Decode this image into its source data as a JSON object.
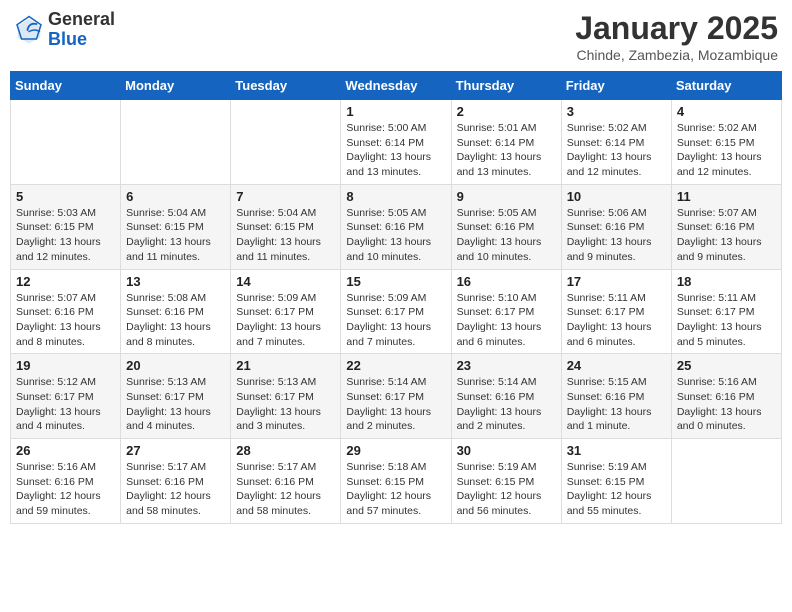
{
  "header": {
    "logo_general": "General",
    "logo_blue": "Blue",
    "month": "January 2025",
    "location": "Chinde, Zambezia, Mozambique"
  },
  "weekdays": [
    "Sunday",
    "Monday",
    "Tuesday",
    "Wednesday",
    "Thursday",
    "Friday",
    "Saturday"
  ],
  "weeks": [
    [
      {
        "day": "",
        "empty": true
      },
      {
        "day": "",
        "empty": true
      },
      {
        "day": "",
        "empty": true
      },
      {
        "day": "1",
        "sunrise": "5:00 AM",
        "sunset": "6:14 PM",
        "daylight": "13 hours and 13 minutes."
      },
      {
        "day": "2",
        "sunrise": "5:01 AM",
        "sunset": "6:14 PM",
        "daylight": "13 hours and 13 minutes."
      },
      {
        "day": "3",
        "sunrise": "5:02 AM",
        "sunset": "6:14 PM",
        "daylight": "13 hours and 12 minutes."
      },
      {
        "day": "4",
        "sunrise": "5:02 AM",
        "sunset": "6:15 PM",
        "daylight": "13 hours and 12 minutes."
      }
    ],
    [
      {
        "day": "5",
        "sunrise": "5:03 AM",
        "sunset": "6:15 PM",
        "daylight": "13 hours and 12 minutes."
      },
      {
        "day": "6",
        "sunrise": "5:04 AM",
        "sunset": "6:15 PM",
        "daylight": "13 hours and 11 minutes."
      },
      {
        "day": "7",
        "sunrise": "5:04 AM",
        "sunset": "6:15 PM",
        "daylight": "13 hours and 11 minutes."
      },
      {
        "day": "8",
        "sunrise": "5:05 AM",
        "sunset": "6:16 PM",
        "daylight": "13 hours and 10 minutes."
      },
      {
        "day": "9",
        "sunrise": "5:05 AM",
        "sunset": "6:16 PM",
        "daylight": "13 hours and 10 minutes."
      },
      {
        "day": "10",
        "sunrise": "5:06 AM",
        "sunset": "6:16 PM",
        "daylight": "13 hours and 9 minutes."
      },
      {
        "day": "11",
        "sunrise": "5:07 AM",
        "sunset": "6:16 PM",
        "daylight": "13 hours and 9 minutes."
      }
    ],
    [
      {
        "day": "12",
        "sunrise": "5:07 AM",
        "sunset": "6:16 PM",
        "daylight": "13 hours and 8 minutes."
      },
      {
        "day": "13",
        "sunrise": "5:08 AM",
        "sunset": "6:16 PM",
        "daylight": "13 hours and 8 minutes."
      },
      {
        "day": "14",
        "sunrise": "5:09 AM",
        "sunset": "6:17 PM",
        "daylight": "13 hours and 7 minutes."
      },
      {
        "day": "15",
        "sunrise": "5:09 AM",
        "sunset": "6:17 PM",
        "daylight": "13 hours and 7 minutes."
      },
      {
        "day": "16",
        "sunrise": "5:10 AM",
        "sunset": "6:17 PM",
        "daylight": "13 hours and 6 minutes."
      },
      {
        "day": "17",
        "sunrise": "5:11 AM",
        "sunset": "6:17 PM",
        "daylight": "13 hours and 6 minutes."
      },
      {
        "day": "18",
        "sunrise": "5:11 AM",
        "sunset": "6:17 PM",
        "daylight": "13 hours and 5 minutes."
      }
    ],
    [
      {
        "day": "19",
        "sunrise": "5:12 AM",
        "sunset": "6:17 PM",
        "daylight": "13 hours and 4 minutes."
      },
      {
        "day": "20",
        "sunrise": "5:13 AM",
        "sunset": "6:17 PM",
        "daylight": "13 hours and 4 minutes."
      },
      {
        "day": "21",
        "sunrise": "5:13 AM",
        "sunset": "6:17 PM",
        "daylight": "13 hours and 3 minutes."
      },
      {
        "day": "22",
        "sunrise": "5:14 AM",
        "sunset": "6:17 PM",
        "daylight": "13 hours and 2 minutes."
      },
      {
        "day": "23",
        "sunrise": "5:14 AM",
        "sunset": "6:16 PM",
        "daylight": "13 hours and 2 minutes."
      },
      {
        "day": "24",
        "sunrise": "5:15 AM",
        "sunset": "6:16 PM",
        "daylight": "13 hours and 1 minute."
      },
      {
        "day": "25",
        "sunrise": "5:16 AM",
        "sunset": "6:16 PM",
        "daylight": "13 hours and 0 minutes."
      }
    ],
    [
      {
        "day": "26",
        "sunrise": "5:16 AM",
        "sunset": "6:16 PM",
        "daylight": "12 hours and 59 minutes."
      },
      {
        "day": "27",
        "sunrise": "5:17 AM",
        "sunset": "6:16 PM",
        "daylight": "12 hours and 58 minutes."
      },
      {
        "day": "28",
        "sunrise": "5:17 AM",
        "sunset": "6:16 PM",
        "daylight": "12 hours and 58 minutes."
      },
      {
        "day": "29",
        "sunrise": "5:18 AM",
        "sunset": "6:15 PM",
        "daylight": "12 hours and 57 minutes."
      },
      {
        "day": "30",
        "sunrise": "5:19 AM",
        "sunset": "6:15 PM",
        "daylight": "12 hours and 56 minutes."
      },
      {
        "day": "31",
        "sunrise": "5:19 AM",
        "sunset": "6:15 PM",
        "daylight": "12 hours and 55 minutes."
      },
      {
        "day": "",
        "empty": true
      }
    ]
  ],
  "labels": {
    "sunrise": "Sunrise:",
    "sunset": "Sunset:",
    "daylight": "Daylight:"
  }
}
